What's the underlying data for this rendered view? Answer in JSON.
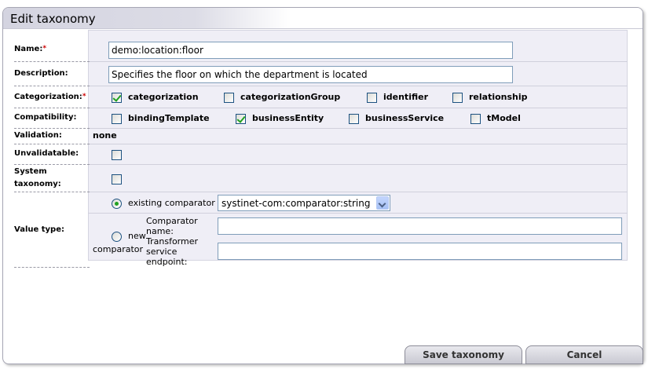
{
  "title": "Edit taxonomy",
  "required_mark": "*",
  "labels": {
    "name": "Name:",
    "description": "Description:",
    "categorization": "Categorization:",
    "compatibility": "Compatibility:",
    "validation": "Validation:",
    "unvalidatable": "Unvalidatable:",
    "system_taxonomy_1": "System",
    "system_taxonomy_2": "taxonomy:",
    "value_type": "Value type:"
  },
  "fields": {
    "name": "demo:location:floor",
    "description": "Specifies the floor on which the department is located"
  },
  "categorization": [
    {
      "label": "categorization",
      "checked": true
    },
    {
      "label": "categorizationGroup",
      "checked": false
    },
    {
      "label": "identifier",
      "checked": false
    },
    {
      "label": "relationship",
      "checked": false
    }
  ],
  "compatibility": [
    {
      "label": "bindingTemplate",
      "checked": false
    },
    {
      "label": "businessEntity",
      "checked": true
    },
    {
      "label": "businessService",
      "checked": false
    },
    {
      "label": "tModel",
      "checked": false
    }
  ],
  "validation_value": "none",
  "unvalidatable_checked": false,
  "system_taxonomy_checked": false,
  "value_type": {
    "existing_label": "existing comparator",
    "existing_selected": true,
    "existing_value": "systinet-com:comparator:string",
    "new_label_1": "new",
    "new_label_2": "comparator",
    "comparator_name_1": "Comparator",
    "comparator_name_2": "name:",
    "transformer_1": "Transformer",
    "transformer_2": "service",
    "transformer_3": "endpoint:",
    "comparator_name_value": "",
    "transformer_value": ""
  },
  "buttons": {
    "save": "Save taxonomy",
    "cancel": "Cancel"
  }
}
